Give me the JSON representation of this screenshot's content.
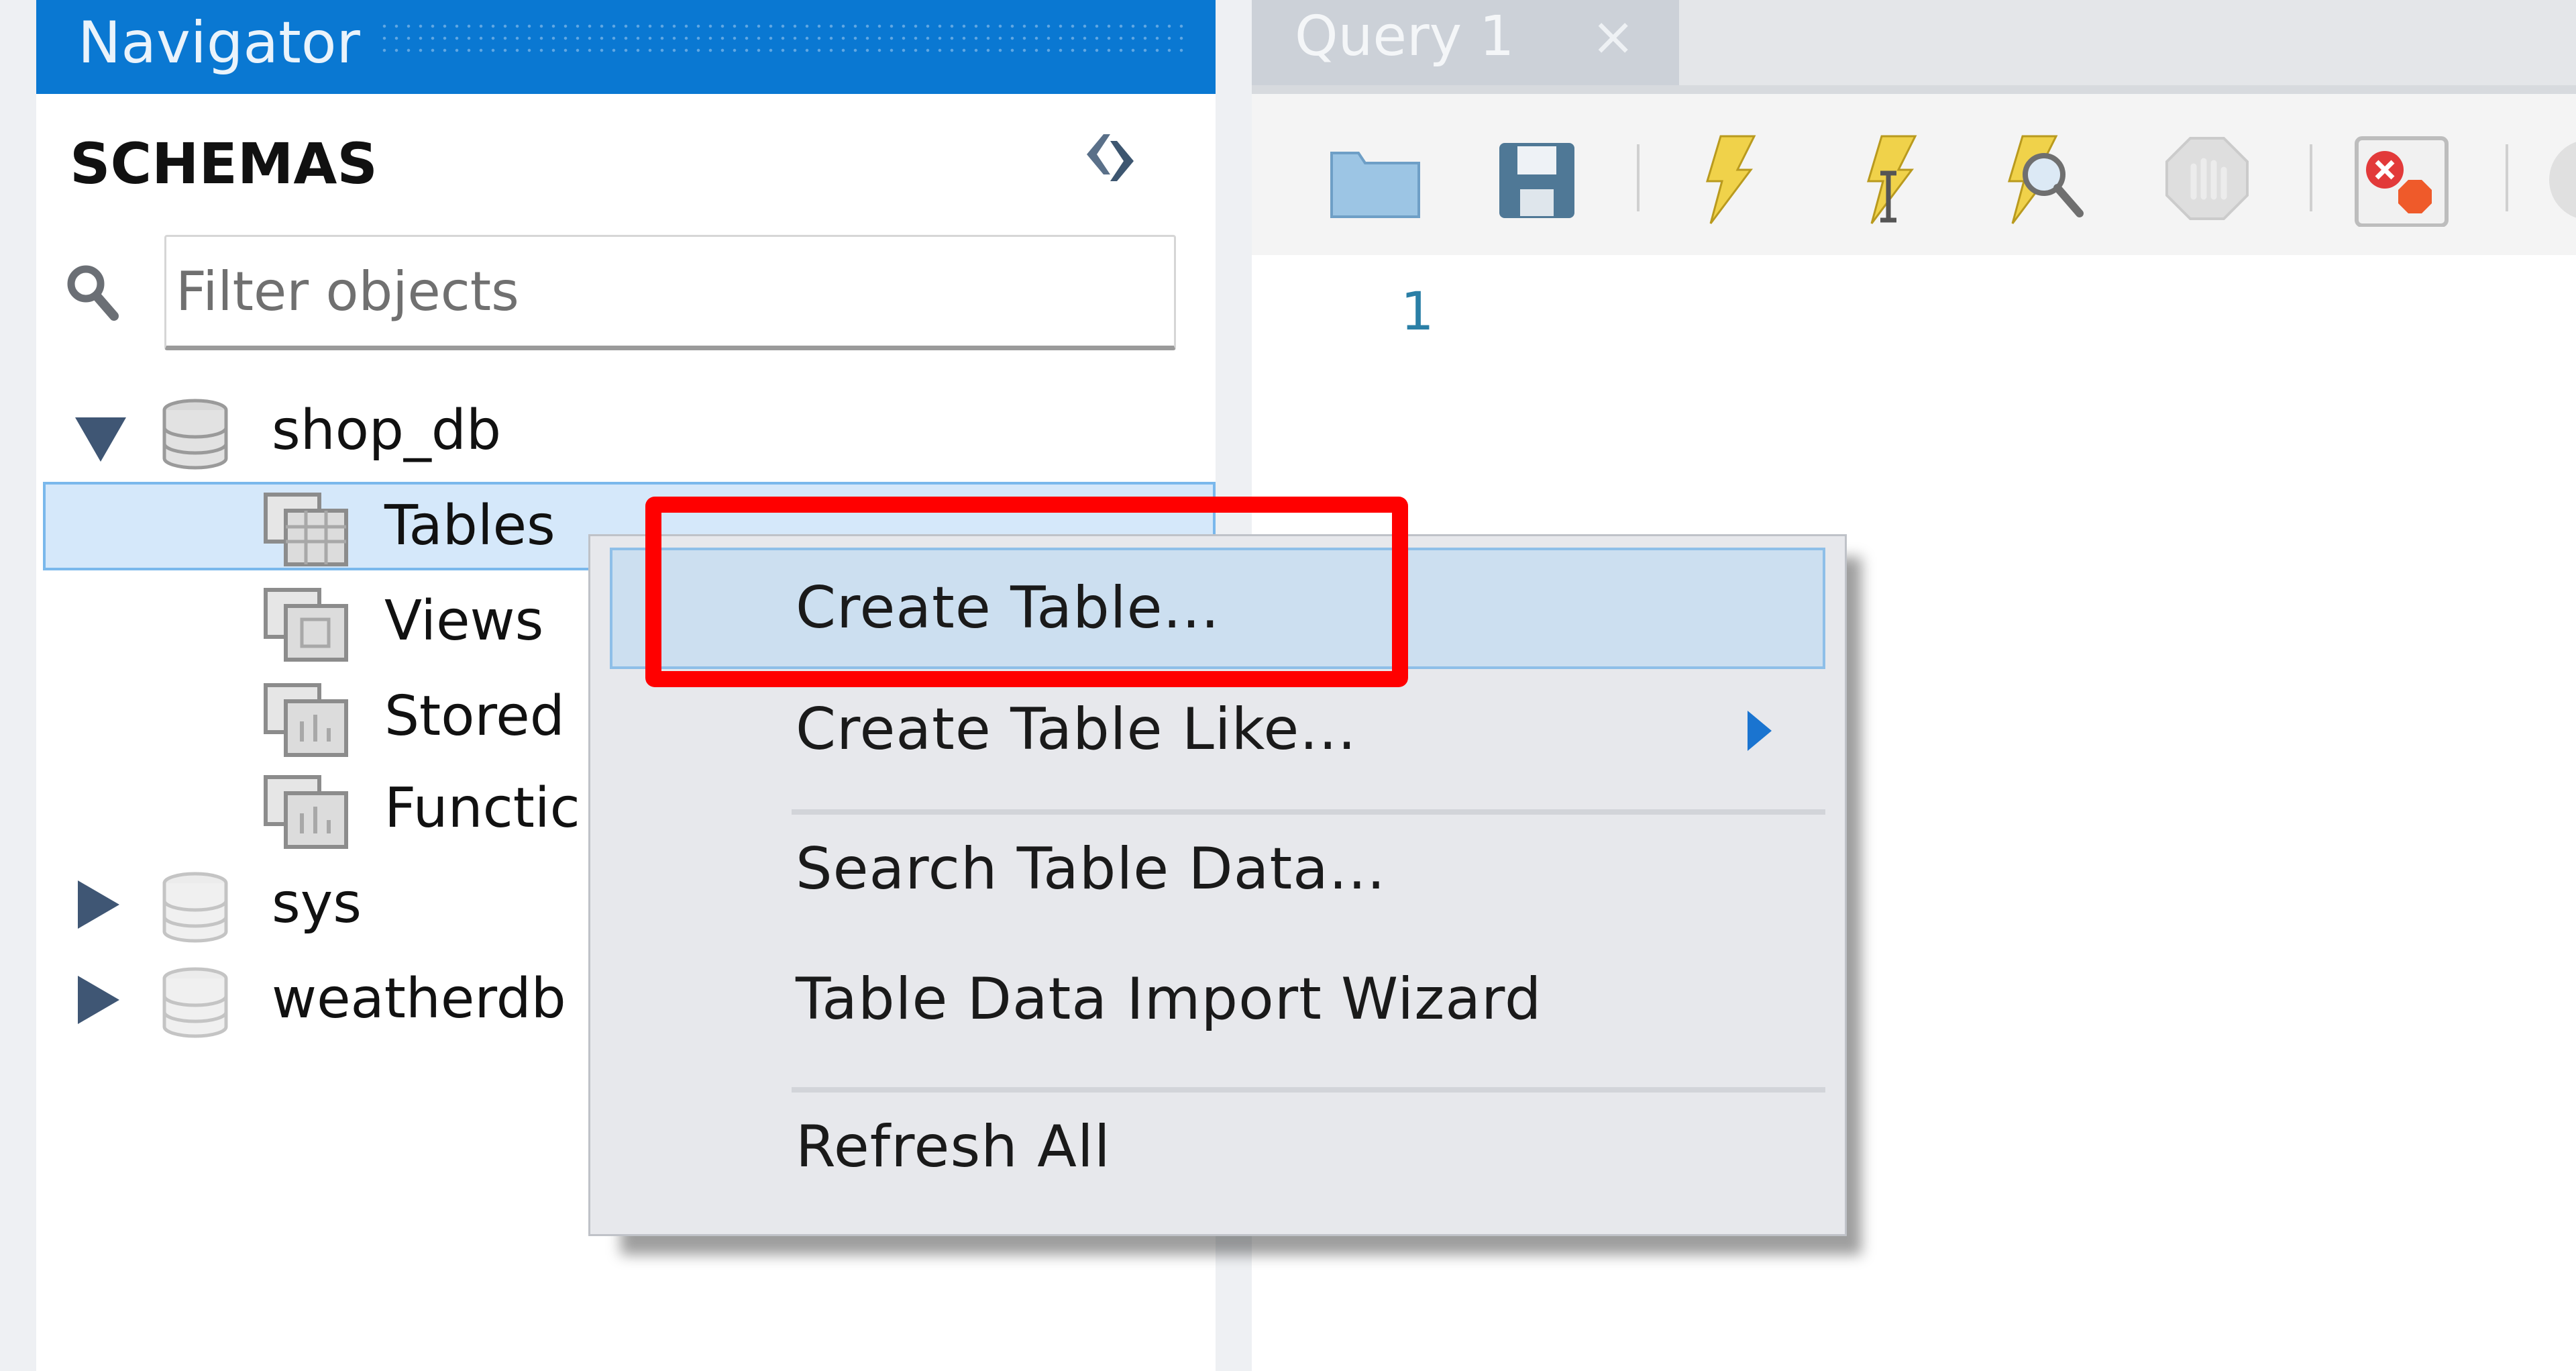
{
  "navigator": {
    "title": "Navigator",
    "section_label": "SCHEMAS",
    "refresh_icon": "refresh-arrows-icon",
    "filter": {
      "placeholder": "Filter objects",
      "value": ""
    },
    "tree": [
      {
        "label": "shop_db",
        "type": "schema",
        "expanded": true,
        "children": [
          {
            "label": "Tables",
            "selected": true
          },
          {
            "label": "Views"
          },
          {
            "label": "Stored"
          },
          {
            "label": "Functic"
          }
        ]
      },
      {
        "label": "sys",
        "type": "schema",
        "expanded": false
      },
      {
        "label": "weatherdb",
        "type": "schema",
        "expanded": false
      }
    ]
  },
  "editor": {
    "tabs": [
      {
        "label": "Query 1",
        "close": "×"
      }
    ],
    "toolbar": [
      {
        "name": "open-sql-file",
        "icon": "folder-icon"
      },
      {
        "name": "save-sql-file",
        "icon": "floppy-disk-icon"
      },
      {
        "name": "execute-all",
        "icon": "lightning-icon"
      },
      {
        "name": "execute-current",
        "icon": "lightning-cursor-icon"
      },
      {
        "name": "explain",
        "icon": "lightning-magnifier-icon"
      },
      {
        "name": "stop",
        "icon": "stop-hand-icon"
      },
      {
        "name": "toggle-stop-on-error",
        "icon": "error-stop-icon"
      }
    ],
    "line_numbers": [
      "1"
    ]
  },
  "context_menu": {
    "items": [
      {
        "label": "Create Table...",
        "highlighted": true
      },
      {
        "label": "Create Table Like...",
        "submenu": true
      },
      {
        "separator": true
      },
      {
        "label": "Search Table Data..."
      },
      {
        "label": "Table Data Import Wizard"
      },
      {
        "separator": true
      },
      {
        "label": "Refresh All"
      }
    ]
  },
  "annotation": {
    "color": "#ff0000",
    "target": "Create Table..."
  },
  "colors": {
    "header_blue": "#0a78d2",
    "selection": "#d5e8fa",
    "menu_bg": "#e7e8ec"
  }
}
